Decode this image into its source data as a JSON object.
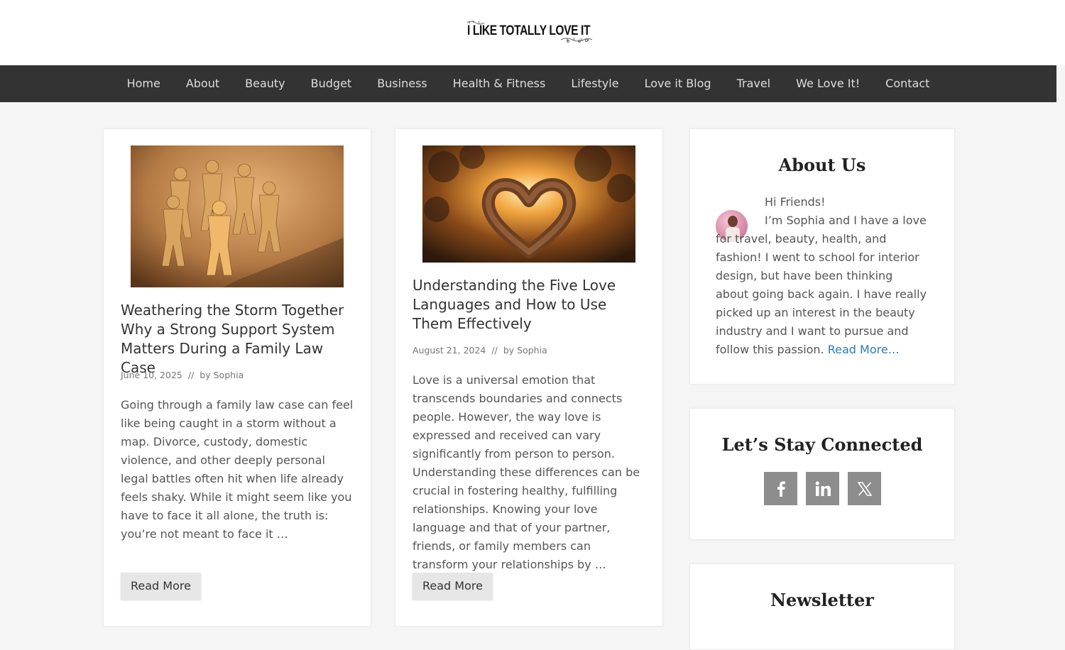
{
  "site": {
    "logo_text": "I LIKE TOTALLY LOVE IT"
  },
  "nav": {
    "items": [
      "Home",
      "About",
      "Beauty",
      "Budget",
      "Business",
      "Health & Fitness",
      "Lifestyle",
      "Love it Blog",
      "Travel",
      "We Love It!",
      "Contact"
    ]
  },
  "posts": [
    {
      "title": "Weathering the Storm Together Why a Strong Support System Matters During a Family Law Case",
      "date": "June 10, 2025",
      "separator": "//",
      "by": "by",
      "author": "Sophia",
      "excerpt": "Going through a family law case can feel like being caught in a storm without a map. Divorce, custody, domestic violence, and other deeply personal legal battles often hit when life already feels shaky. While it might seem like you have to face it all alone, the truth is: you’re not meant to face it …",
      "button": "Read More"
    },
    {
      "title": "Understanding the Five Love Languages and How to Use Them Effectively",
      "date": "August 21, 2024",
      "separator": "//",
      "by": "by",
      "author": "Sophia",
      "excerpt": "Love is a universal emotion that transcends boundaries and connects people. However, the way love is expressed and received can vary significantly from person to person. Understanding these differences can be crucial in fostering healthy, fulfilling relationships. Knowing your love language and that of your partner, friends, or family members can transform your relationships by …",
      "button": "Read More"
    }
  ],
  "sidebar": {
    "about": {
      "title": "About Us",
      "greeting": "Hi Friends!",
      "body": "I’m Sophia and I have a love for travel, beauty, health, and fashion! I went to school for interior design, but have been thinking about going back again. I have really picked up an interest in the beauty industry and I want to pursue and follow this passion.",
      "read_more": "Read More…"
    },
    "connect": {
      "title": "Let’s Stay Connected",
      "icons": [
        "facebook-icon",
        "linkedin-icon",
        "x-twitter-icon"
      ]
    },
    "newsletter": {
      "title": "Newsletter"
    }
  },
  "colors": {
    "nav_bg": "#333333",
    "link": "#2a7ab8",
    "social_bg": "#8d8d8d"
  }
}
